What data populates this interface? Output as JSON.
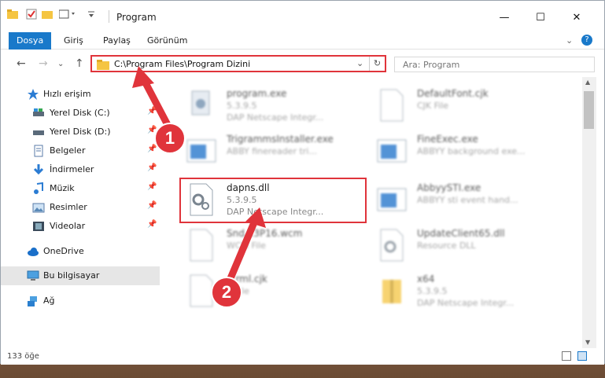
{
  "window": {
    "title": "Program"
  },
  "ribbon": {
    "tabs": [
      "Dosya",
      "Giriş",
      "Paylaş",
      "Görünüm"
    ]
  },
  "address": {
    "path": "C:\\Program Files\\Program Dizini",
    "search_placeholder": "Ara: Program"
  },
  "nav": {
    "quick_access": "Hızlı erişim",
    "items": [
      "Yerel Disk (C:)",
      "Yerel Disk (D:)",
      "Belgeler",
      "İndirmeler",
      "Müzik",
      "Resimler",
      "Videolar"
    ],
    "onedrive": "OneDrive",
    "thispc": "Bu bilgisayar",
    "network": "Ağ"
  },
  "files": {
    "left": [
      {
        "name": "program.exe",
        "l2": "5.3.9.5",
        "l3": "DAP Netscape Integr..."
      },
      {
        "name": "TrigrammsInstaller.exe",
        "l2": "ABBY finereader tri..."
      },
      {
        "name": "dapns.dll",
        "l2": "5.3.9.5",
        "l3": "DAP Netscape Integr..."
      },
      {
        "name": "Snd...3P16.wcm",
        "l2": "WCM File"
      },
      {
        "name": "...rml.cjk",
        "l2": "...File"
      }
    ],
    "right": [
      {
        "name": "DefaultFont.cjk",
        "l2": "CJK File"
      },
      {
        "name": "FineExec.exe",
        "l2": "ABBYY background exe..."
      },
      {
        "name": "AbbyySTI.exe",
        "l2": "ABBYY sti event hand..."
      },
      {
        "name": "UpdateClient65.dll",
        "l2": "Resource DLL"
      },
      {
        "name": "x64",
        "l2": "5.3.9.5",
        "l3": "DAP Netscape Integr..."
      }
    ]
  },
  "status": {
    "count": "133 öğe"
  },
  "callouts": [
    "1",
    "2"
  ]
}
